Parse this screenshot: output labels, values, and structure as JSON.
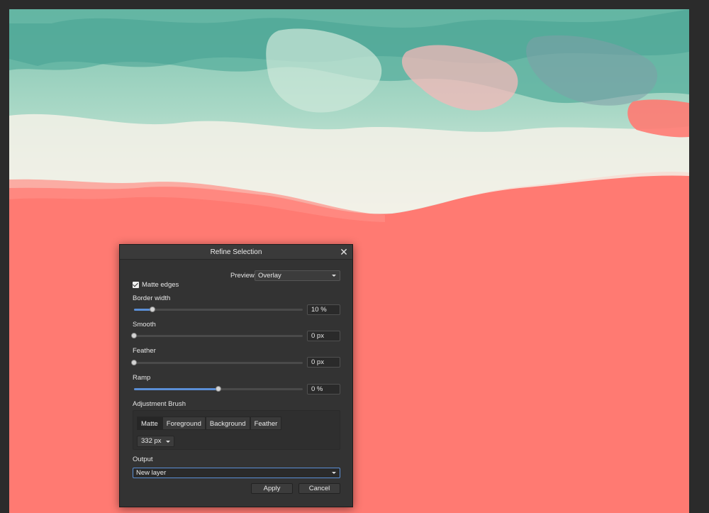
{
  "dialog": {
    "title": "Refine Selection",
    "close_glyph": "✕",
    "preview": {
      "label": "Preview",
      "value": "Overlay"
    },
    "matte_edges": {
      "label": "Matte edges",
      "checked": true
    },
    "sliders": [
      {
        "label": "Border width",
        "value": "10 %",
        "fraction": 0.11
      },
      {
        "label": "Smooth",
        "value": "0 px",
        "fraction": 0.0
      },
      {
        "label": "Feather",
        "value": "0 px",
        "fraction": 0.0
      },
      {
        "label": "Ramp",
        "value": "0 %",
        "fraction": 0.5
      }
    ],
    "adjustment_brush": {
      "label": "Adjustment Brush",
      "tabs": [
        "Matte",
        "Foreground",
        "Background",
        "Feather"
      ],
      "active_tab": "Matte",
      "size": "332 px"
    },
    "output": {
      "label": "Output",
      "value": "New layer"
    },
    "buttons": {
      "apply": "Apply",
      "cancel": "Cancel"
    }
  },
  "colors": {
    "selection_overlay": "#ff7a72",
    "accent": "#5b8fd6",
    "dialog_bg": "#333333"
  },
  "icons": {
    "close": "close-icon",
    "checkbox": "checkmark-icon",
    "dropdown": "chevron-down-icon"
  }
}
